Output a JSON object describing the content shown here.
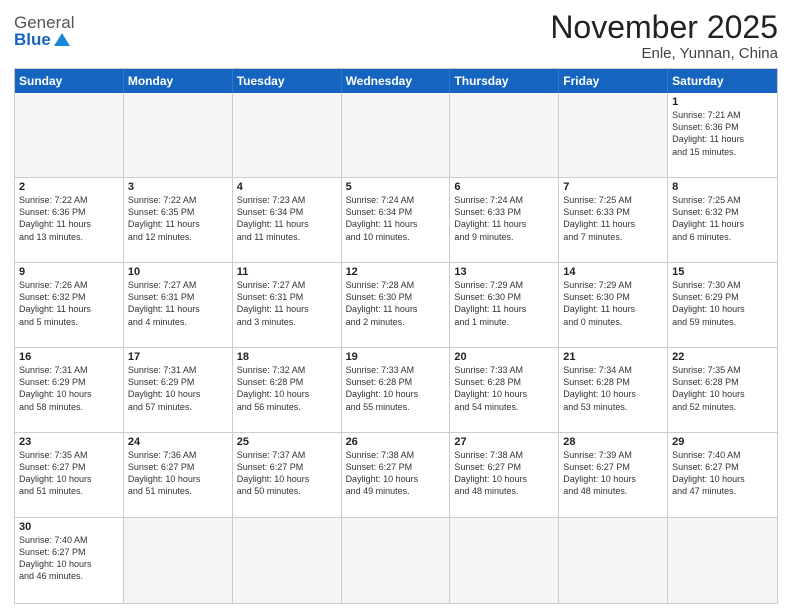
{
  "header": {
    "logo_general": "General",
    "logo_blue": "Blue",
    "month_title": "November 2025",
    "location": "Enle, Yunnan, China"
  },
  "weekdays": [
    "Sunday",
    "Monday",
    "Tuesday",
    "Wednesday",
    "Thursday",
    "Friday",
    "Saturday"
  ],
  "weeks": [
    [
      {
        "day": "",
        "info": ""
      },
      {
        "day": "",
        "info": ""
      },
      {
        "day": "",
        "info": ""
      },
      {
        "day": "",
        "info": ""
      },
      {
        "day": "",
        "info": ""
      },
      {
        "day": "",
        "info": ""
      },
      {
        "day": "1",
        "info": "Sunrise: 7:21 AM\nSunset: 6:36 PM\nDaylight: 11 hours\nand 15 minutes."
      }
    ],
    [
      {
        "day": "2",
        "info": "Sunrise: 7:22 AM\nSunset: 6:36 PM\nDaylight: 11 hours\nand 13 minutes."
      },
      {
        "day": "3",
        "info": "Sunrise: 7:22 AM\nSunset: 6:35 PM\nDaylight: 11 hours\nand 12 minutes."
      },
      {
        "day": "4",
        "info": "Sunrise: 7:23 AM\nSunset: 6:34 PM\nDaylight: 11 hours\nand 11 minutes."
      },
      {
        "day": "5",
        "info": "Sunrise: 7:24 AM\nSunset: 6:34 PM\nDaylight: 11 hours\nand 10 minutes."
      },
      {
        "day": "6",
        "info": "Sunrise: 7:24 AM\nSunset: 6:33 PM\nDaylight: 11 hours\nand 9 minutes."
      },
      {
        "day": "7",
        "info": "Sunrise: 7:25 AM\nSunset: 6:33 PM\nDaylight: 11 hours\nand 7 minutes."
      },
      {
        "day": "8",
        "info": "Sunrise: 7:25 AM\nSunset: 6:32 PM\nDaylight: 11 hours\nand 6 minutes."
      }
    ],
    [
      {
        "day": "9",
        "info": "Sunrise: 7:26 AM\nSunset: 6:32 PM\nDaylight: 11 hours\nand 5 minutes."
      },
      {
        "day": "10",
        "info": "Sunrise: 7:27 AM\nSunset: 6:31 PM\nDaylight: 11 hours\nand 4 minutes."
      },
      {
        "day": "11",
        "info": "Sunrise: 7:27 AM\nSunset: 6:31 PM\nDaylight: 11 hours\nand 3 minutes."
      },
      {
        "day": "12",
        "info": "Sunrise: 7:28 AM\nSunset: 6:30 PM\nDaylight: 11 hours\nand 2 minutes."
      },
      {
        "day": "13",
        "info": "Sunrise: 7:29 AM\nSunset: 6:30 PM\nDaylight: 11 hours\nand 1 minute."
      },
      {
        "day": "14",
        "info": "Sunrise: 7:29 AM\nSunset: 6:30 PM\nDaylight: 11 hours\nand 0 minutes."
      },
      {
        "day": "15",
        "info": "Sunrise: 7:30 AM\nSunset: 6:29 PM\nDaylight: 10 hours\nand 59 minutes."
      }
    ],
    [
      {
        "day": "16",
        "info": "Sunrise: 7:31 AM\nSunset: 6:29 PM\nDaylight: 10 hours\nand 58 minutes."
      },
      {
        "day": "17",
        "info": "Sunrise: 7:31 AM\nSunset: 6:29 PM\nDaylight: 10 hours\nand 57 minutes."
      },
      {
        "day": "18",
        "info": "Sunrise: 7:32 AM\nSunset: 6:28 PM\nDaylight: 10 hours\nand 56 minutes."
      },
      {
        "day": "19",
        "info": "Sunrise: 7:33 AM\nSunset: 6:28 PM\nDaylight: 10 hours\nand 55 minutes."
      },
      {
        "day": "20",
        "info": "Sunrise: 7:33 AM\nSunset: 6:28 PM\nDaylight: 10 hours\nand 54 minutes."
      },
      {
        "day": "21",
        "info": "Sunrise: 7:34 AM\nSunset: 6:28 PM\nDaylight: 10 hours\nand 53 minutes."
      },
      {
        "day": "22",
        "info": "Sunrise: 7:35 AM\nSunset: 6:28 PM\nDaylight: 10 hours\nand 52 minutes."
      }
    ],
    [
      {
        "day": "23",
        "info": "Sunrise: 7:35 AM\nSunset: 6:27 PM\nDaylight: 10 hours\nand 51 minutes."
      },
      {
        "day": "24",
        "info": "Sunrise: 7:36 AM\nSunset: 6:27 PM\nDaylight: 10 hours\nand 51 minutes."
      },
      {
        "day": "25",
        "info": "Sunrise: 7:37 AM\nSunset: 6:27 PM\nDaylight: 10 hours\nand 50 minutes."
      },
      {
        "day": "26",
        "info": "Sunrise: 7:38 AM\nSunset: 6:27 PM\nDaylight: 10 hours\nand 49 minutes."
      },
      {
        "day": "27",
        "info": "Sunrise: 7:38 AM\nSunset: 6:27 PM\nDaylight: 10 hours\nand 48 minutes."
      },
      {
        "day": "28",
        "info": "Sunrise: 7:39 AM\nSunset: 6:27 PM\nDaylight: 10 hours\nand 48 minutes."
      },
      {
        "day": "29",
        "info": "Sunrise: 7:40 AM\nSunset: 6:27 PM\nDaylight: 10 hours\nand 47 minutes."
      }
    ],
    [
      {
        "day": "30",
        "info": "Sunrise: 7:40 AM\nSunset: 6:27 PM\nDaylight: 10 hours\nand 46 minutes."
      },
      {
        "day": "",
        "info": ""
      },
      {
        "day": "",
        "info": ""
      },
      {
        "day": "",
        "info": ""
      },
      {
        "day": "",
        "info": ""
      },
      {
        "day": "",
        "info": ""
      },
      {
        "day": "",
        "info": ""
      }
    ]
  ]
}
